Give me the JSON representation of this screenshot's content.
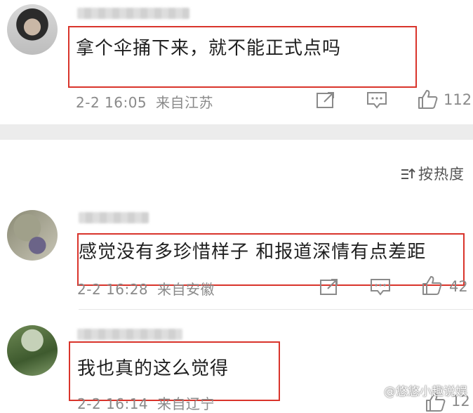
{
  "comments": [
    {
      "username": "████████",
      "text": "拿个伞捅下来，就不能正式点吗",
      "time": "2-2 16:05",
      "location": "来自江苏",
      "likes": "112"
    },
    {
      "username": "██████",
      "text": "感觉没有多珍惜样子 和报道深情有点差距",
      "time": "2-2 16:28",
      "location": "来自安徽",
      "likes": "42"
    },
    {
      "username": "████████",
      "text": "我也真的这么觉得",
      "time": "2-2 16:14",
      "location": "来自辽宁",
      "likes": "12"
    }
  ],
  "sort": {
    "label": "按热度"
  },
  "watermark": "@悠悠小趣说娱",
  "colors": {
    "highlight_box": "#d9342b",
    "meta_text": "#8a8a8a",
    "separator_band": "#ececec"
  },
  "icons": [
    "share-icon",
    "comment-icon",
    "like-icon",
    "sort-icon"
  ]
}
